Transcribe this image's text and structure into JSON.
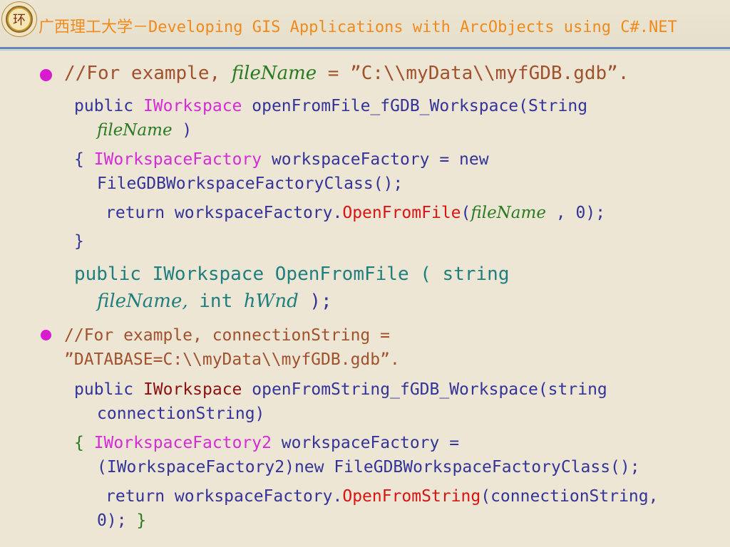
{
  "header": {
    "title": "广西理工大学－Developing GIS Applications with ArcObjects using C#.NET",
    "logo_char": "环"
  },
  "slide": {
    "b1": {
      "comment_prefix": "//For example,",
      "var": "fileName",
      "eq": " = ",
      "path": "”C:\\\\myData\\\\myfGDB.gdb”."
    },
    "fn1": {
      "l1_public": "public ",
      "l1_type": "IWorkspace",
      "l1_rest": " openFromFile_fGDB_Workspace(String",
      "l2_param": "fileName",
      "l2_close": " )",
      "l3_brace": "{ ",
      "l3_type": "IWorkspaceFactory",
      "l3_rest": " workspaceFactory = new",
      "l4": "FileGDBWorkspaceFactoryClass();",
      "l5_ret": "return workspaceFactory.",
      "l5_method": "OpenFromFile",
      "l5_open": "(",
      "l5_param": "fileName",
      "l5_close": " , 0);",
      "l6_brace": "}"
    },
    "sig1": {
      "l1": "public IWorkspace OpenFromFile ( string",
      "l2_param1": "fileName,",
      "l2_int": " int ",
      "l2_param2": "hWnd",
      "l2_close": " );"
    },
    "b2": {
      "l1": "//For example, connectionString =",
      "l2": "”DATABASE=C:\\\\myData\\\\myfGDB.gdb”."
    },
    "fn2": {
      "l1_public": "public ",
      "l1_type": "IWorkspace",
      "l1_rest": " openFromString_fGDB_Workspace(string",
      "l2": "connectionString)",
      "l3_brace": "{ ",
      "l3_type": "IWorkspaceFactory2",
      "l3_rest": " workspaceFactory =",
      "l4": "(IWorkspaceFactory2)new FileGDBWorkspaceFactoryClass();",
      "l5_ret": "return workspaceFactory.",
      "l5_method": "OpenFromString",
      "l5_rest": "(connectionString,",
      "l6": "0); ",
      "l6_brace": "}"
    }
  },
  "colors": {
    "background": "#ede6d4",
    "title": "#f08a1c",
    "bullet": "#d81ad0",
    "comment": "#a0522d",
    "keyword": "#33339a",
    "type": "#d62bd6",
    "method": "#d81414",
    "signature": "#1f7f7f"
  }
}
